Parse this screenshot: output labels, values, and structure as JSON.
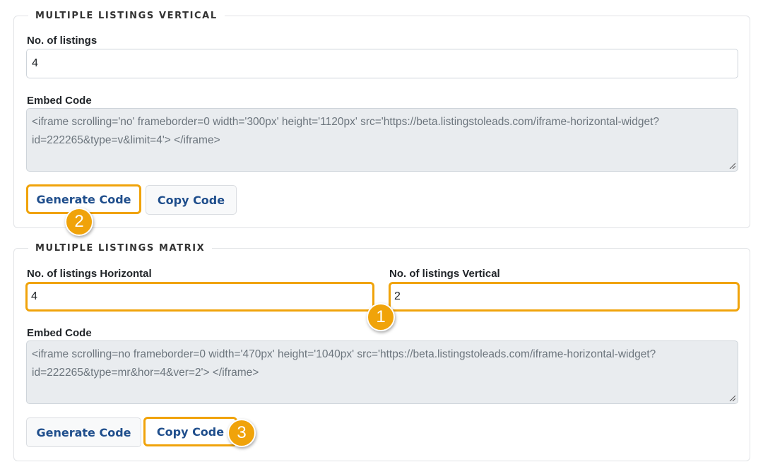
{
  "vertical": {
    "legend": "MULTIPLE LISTINGS VERTICAL",
    "listings_label": "No. of listings",
    "listings_value": "4",
    "embed_label": "Embed Code",
    "embed_code": "<iframe scrolling='no' frameborder=0 width='300px' height='1120px'  src='https://beta.listingstoleads.com/iframe-horizontal-widget?id=222265&type=v&limit=4'> </iframe>",
    "generate_label": "Generate Code",
    "copy_label": "Copy Code"
  },
  "matrix": {
    "legend": "MULTIPLE LISTINGS MATRIX",
    "horizontal_label": "No. of listings Horizontal",
    "horizontal_value": "4",
    "vertical_label": "No. of listings Vertical",
    "vertical_value": "2",
    "embed_label": "Embed Code",
    "embed_code": "<iframe scrolling=no frameborder=0 width='470px' height='1040px' src='https://beta.listingstoleads.com/iframe-horizontal-widget?id=222265&type=mr&hor=4&ver=2'> </iframe>",
    "generate_label": "Generate Code",
    "copy_label": "Copy Code"
  },
  "callouts": {
    "one": "1",
    "two": "2",
    "three": "3",
    "color": "#f0a30a"
  }
}
